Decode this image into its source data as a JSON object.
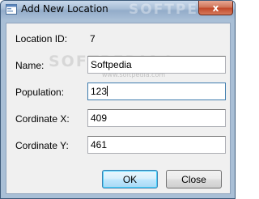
{
  "window": {
    "title": "Add New Location",
    "watermark_title": "SOFTPEDIA",
    "close_glyph": "x"
  },
  "form": {
    "location_id": {
      "label": "Location ID:",
      "value": "7"
    },
    "name": {
      "label": "Name:",
      "value": "Softpedia"
    },
    "population": {
      "label": "Population:",
      "value": "123"
    },
    "coord_x": {
      "label": "Cordinate X:",
      "value": "409"
    },
    "coord_y": {
      "label": "Cordinate Y:",
      "value": "461"
    }
  },
  "watermark": {
    "text": "SOFTPEDIA®",
    "url": "www.softpedia.com"
  },
  "buttons": {
    "ok_label": "OK",
    "close_label": "Close"
  },
  "icons": {
    "app": "form-window-icon",
    "close": "close-icon"
  },
  "colors": {
    "titlebar": "#a7bdd6",
    "client_bg": "#f0f0f0",
    "close_button": "#c24a2c",
    "default_button_border": "#3c7fb1"
  }
}
